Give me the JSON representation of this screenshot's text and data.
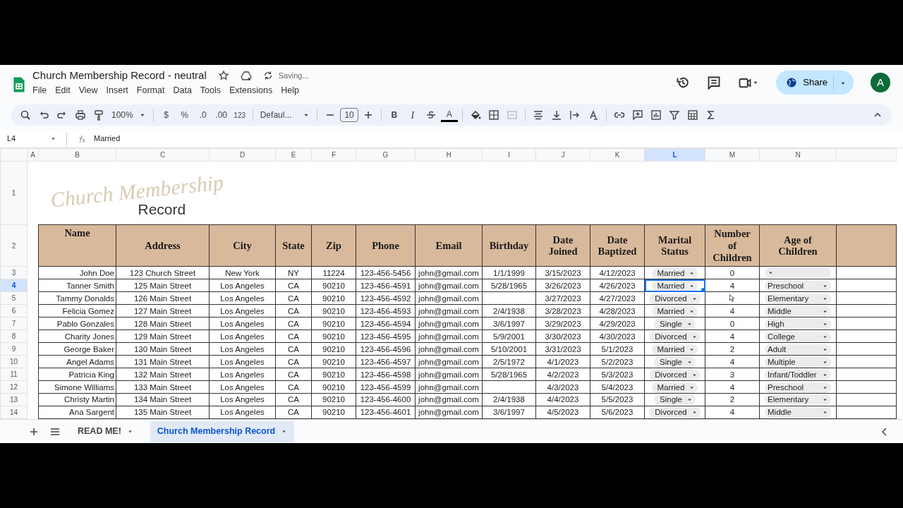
{
  "document": {
    "title": "Church Membership Record - neutral",
    "status": "Saving..."
  },
  "menu": [
    "File",
    "Edit",
    "View",
    "Insert",
    "Format",
    "Data",
    "Tools",
    "Extensions",
    "Help"
  ],
  "toolbar": {
    "zoom": "100%",
    "currency": "$",
    "percent": "%",
    "decrease_decimals": ".0",
    "increase_decimals": ".00",
    "number_format": "123",
    "font": "Defaul...",
    "font_size": "10",
    "bold": "B",
    "italic": "I",
    "text_color": "A"
  },
  "share": {
    "label": "Share"
  },
  "avatar": {
    "initial": "A"
  },
  "formula_bar": {
    "cell_ref": "L4",
    "value": "Married"
  },
  "columns": [
    {
      "letter": "A",
      "selected": false
    },
    {
      "letter": "B",
      "selected": false
    },
    {
      "letter": "C",
      "selected": false
    },
    {
      "letter": "D",
      "selected": false
    },
    {
      "letter": "E",
      "selected": false
    },
    {
      "letter": "F",
      "selected": false
    },
    {
      "letter": "G",
      "selected": false
    },
    {
      "letter": "H",
      "selected": false
    },
    {
      "letter": "I",
      "selected": false
    },
    {
      "letter": "J",
      "selected": false
    },
    {
      "letter": "K",
      "selected": false
    },
    {
      "letter": "L",
      "selected": true
    },
    {
      "letter": "M",
      "selected": false
    },
    {
      "letter": "N",
      "selected": false
    }
  ],
  "banner": {
    "row": "1",
    "script": "Church Membership",
    "word": "Record"
  },
  "header": {
    "row": "2",
    "labels": [
      "Name",
      "Address",
      "City",
      "State",
      "Zip",
      "Phone",
      "Email",
      "Birthday",
      "Date Joined",
      "Date Baptized",
      "Marital Status",
      "Number of Children",
      "Age of Children"
    ]
  },
  "rows": [
    {
      "number": "3",
      "selected": false,
      "name": "John Doe",
      "address": "123 Church Street",
      "city": "New York",
      "state": "NY",
      "zip": "11224",
      "phone": "123-456-5456",
      "email": "john@gmail.com",
      "birthday": "1/1/1999",
      "joined": "3/15/2023",
      "baptized": "4/12/2023",
      "marital": "Married",
      "children": "0"
    },
    {
      "number": "4",
      "selected": true,
      "name": "Tanner Smith",
      "address": "125 Main Street",
      "city": "Los Angeles",
      "state": "CA",
      "zip": "90210",
      "phone": "123-456-4591",
      "email": "john@gmail.com",
      "birthday": "5/28/1965",
      "joined": "3/26/2023",
      "baptized": "4/26/2023",
      "marital": "Married",
      "children": "4",
      "age": "Preschool"
    },
    {
      "number": "5",
      "selected": false,
      "name": "Tammy Donalds",
      "address": "126 Main Street",
      "city": "Los Angeles",
      "state": "CA",
      "zip": "90210",
      "phone": "123-456-4592",
      "email": "john@gmail.com",
      "joined": "3/27/2023",
      "baptized": "4/27/2023",
      "marital": "Divorced",
      "age": "Elementary"
    },
    {
      "number": "6",
      "selected": false,
      "name": "Felicia Gomez",
      "address": "127 Main Street",
      "city": "Los Angeles",
      "state": "CA",
      "zip": "90210",
      "phone": "123-456-4593",
      "email": "john@gmail.com",
      "birthday": "2/4/1938",
      "joined": "3/28/2023",
      "baptized": "4/28/2023",
      "marital": "Married",
      "children": "4",
      "age": "Middle"
    },
    {
      "number": "7",
      "selected": false,
      "name": "Pablo Gonzales",
      "address": "128 Main Street",
      "city": "Los Angeles",
      "state": "CA",
      "zip": "90210",
      "phone": "123-456-4594",
      "email": "john@gmail.com",
      "birthday": "3/6/1997",
      "joined": "3/29/2023",
      "baptized": "4/29/2023",
      "marital": "Single",
      "children": "0",
      "age": "High"
    },
    {
      "number": "8",
      "selected": false,
      "name": "Charity Jones",
      "address": "129 Main Street",
      "city": "Los Angeles",
      "state": "CA",
      "zip": "90210",
      "phone": "123-456-4595",
      "email": "john@gmail.com",
      "birthday": "5/9/2001",
      "joined": "3/30/2023",
      "baptized": "4/30/2023",
      "marital": "Divorced",
      "children": "4",
      "age": "College"
    },
    {
      "number": "9",
      "selected": false,
      "name": "George Baker",
      "address": "130 Main Street",
      "city": "Los Angeles",
      "state": "CA",
      "zip": "90210",
      "phone": "123-456-4596",
      "email": "john@gmail.com",
      "birthday": "5/10/2001",
      "joined": "3/31/2023",
      "baptized": "5/1/2023",
      "marital": "Married",
      "children": "2",
      "age": "Adult"
    },
    {
      "number": "10",
      "selected": false,
      "name": "Angel Adams",
      "address": "131 Main Street",
      "city": "Los Angeles",
      "state": "CA",
      "zip": "90210",
      "phone": "123-456-4597",
      "email": "john@gmail.com",
      "birthday": "2/5/1972",
      "joined": "4/1/2023",
      "baptized": "5/2/2023",
      "marital": "Single",
      "children": "4",
      "age": "Multiple"
    },
    {
      "number": "11",
      "selected": false,
      "name": "Patricia King",
      "address": "132 Main Street",
      "city": "Los Angeles",
      "state": "CA",
      "zip": "90210",
      "phone": "123-456-4598",
      "email": "john@gmail.com",
      "birthday": "5/28/1965",
      "joined": "4/2/2023",
      "baptized": "5/3/2023",
      "marital": "Divorced",
      "children": "3",
      "age": "Infant/Toddler"
    },
    {
      "number": "12",
      "selected": false,
      "name": "Simone Williams",
      "address": "133 Main Street",
      "city": "Los Angeles",
      "state": "CA",
      "zip": "90210",
      "phone": "123-456-4599",
      "email": "john@gmail.com",
      "joined": "4/3/2023",
      "baptized": "5/4/2023",
      "marital": "Married",
      "children": "4",
      "age": "Preschool"
    },
    {
      "number": "13",
      "selected": false,
      "name": "Christy Martin",
      "address": "134 Main Street",
      "city": "Los Angeles",
      "state": "CA",
      "zip": "90210",
      "phone": "123-456-4600",
      "email": "john@gmail.com",
      "birthday": "2/4/1938",
      "joined": "4/4/2023",
      "baptized": "5/5/2023",
      "marital": "Single",
      "children": "2",
      "age": "Elementary"
    },
    {
      "number": "14",
      "selected": false,
      "name": "Ana Sargent",
      "address": "135 Main Street",
      "city": "Los Angeles",
      "state": "CA",
      "zip": "90210",
      "phone": "123-456-4601",
      "email": "john@gmail.com",
      "birthday": "3/6/1997",
      "joined": "4/5/2023",
      "baptized": "5/6/2023",
      "marital": "Divorced",
      "children": "4",
      "age": "Middle"
    }
  ],
  "sheet_tabs": [
    {
      "label": "READ ME!",
      "selected": false
    },
    {
      "label": "Church Membership Record",
      "selected": true
    }
  ]
}
